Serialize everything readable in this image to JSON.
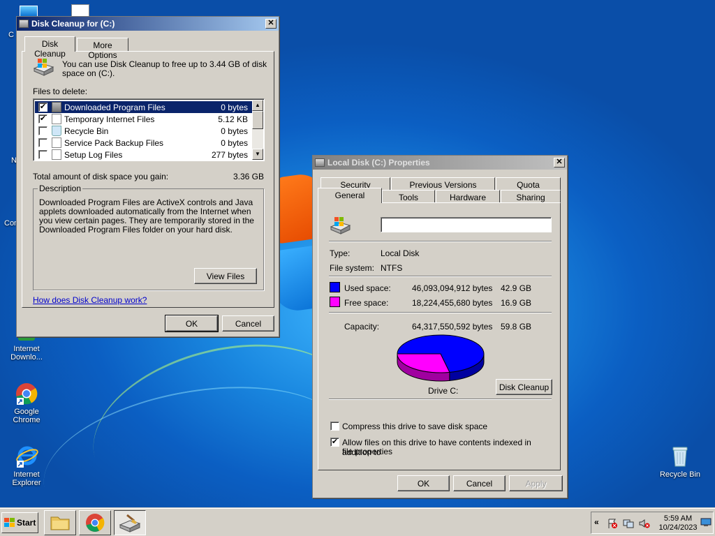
{
  "desktop": {
    "icons": [
      {
        "id": "internet-download",
        "line1": "Internet",
        "line2": "Downlo..."
      },
      {
        "id": "google-chrome",
        "line1": "Google Chrome",
        "line2": ""
      },
      {
        "id": "internet-explorer",
        "line1": "Internet",
        "line2": "Explorer"
      },
      {
        "id": "recycle-bin",
        "line1": "Recycle Bin",
        "line2": ""
      }
    ],
    "partial_labels": [
      "C",
      "N",
      "Con"
    ]
  },
  "cleanup": {
    "title": "Disk Cleanup for  (C:)",
    "close": "✕",
    "tabs": [
      "Disk Cleanup",
      "More Options"
    ],
    "intro_line1": "You can use Disk Cleanup to free up to 3.44 GB of disk",
    "intro_line2": "space on  (C:).",
    "files_label": "Files to delete:",
    "files": [
      {
        "name": "Downloaded Program Files",
        "size": "0 bytes",
        "checked": "✔"
      },
      {
        "name": "Temporary Internet Files",
        "size": "5.12 KB",
        "checked": "✔"
      },
      {
        "name": "Recycle Bin",
        "size": "0 bytes",
        "checked": ""
      },
      {
        "name": "Service Pack Backup Files",
        "size": "0 bytes",
        "checked": ""
      },
      {
        "name": "Setup Log Files",
        "size": "277 bytes",
        "checked": ""
      }
    ],
    "total_label": "Total amount of disk space you gain:",
    "total_value": "3.36 GB",
    "description_title": "Description",
    "description": "Downloaded Program Files are ActiveX controls and Java applets downloaded automatically from the Internet when you view certain pages. They are temporarily stored in the Downloaded Program Files folder on your hard disk.",
    "view_files": "View Files",
    "help_link": "How does Disk Cleanup work?",
    "ok": "OK",
    "cancel": "Cancel"
  },
  "props": {
    "title": "Local Disk (C:) Properties",
    "close": "✕",
    "tabs_row1": [
      "Security",
      "Previous Versions",
      "Quota"
    ],
    "tabs_row2": [
      "General",
      "Tools",
      "Hardware",
      "Sharing"
    ],
    "label_value": "",
    "type_label": "Type:",
    "type_value": "Local Disk",
    "fs_label": "File system:",
    "fs_value": "NTFS",
    "used_label": "Used space:",
    "used_bytes": "46,093,094,912 bytes",
    "used_gb": "42.9 GB",
    "free_label": "Free space:",
    "free_bytes": "18,224,455,680 bytes",
    "free_gb": "16.9 GB",
    "capacity_label": "Capacity:",
    "capacity_bytes": "64,317,550,592 bytes",
    "capacity_gb": "59.8 GB",
    "used_fraction": 0.7166,
    "used_color": "#0000ff",
    "free_color": "#ff00ff",
    "drive_label": "Drive C:",
    "disk_cleanup": "Disk Cleanup",
    "compress": "Compress this drive to save disk space",
    "compress_checked": "",
    "index_line1": "Allow files on this drive to have contents indexed in addition to",
    "index_line2": "file properties",
    "index_checked": "✔",
    "ok": "OK",
    "cancel": "Cancel",
    "apply": "Apply"
  },
  "taskbar": {
    "start": "Start",
    "time": "5:59 AM",
    "date": "10/24/2023",
    "tray_arrow": "«"
  }
}
